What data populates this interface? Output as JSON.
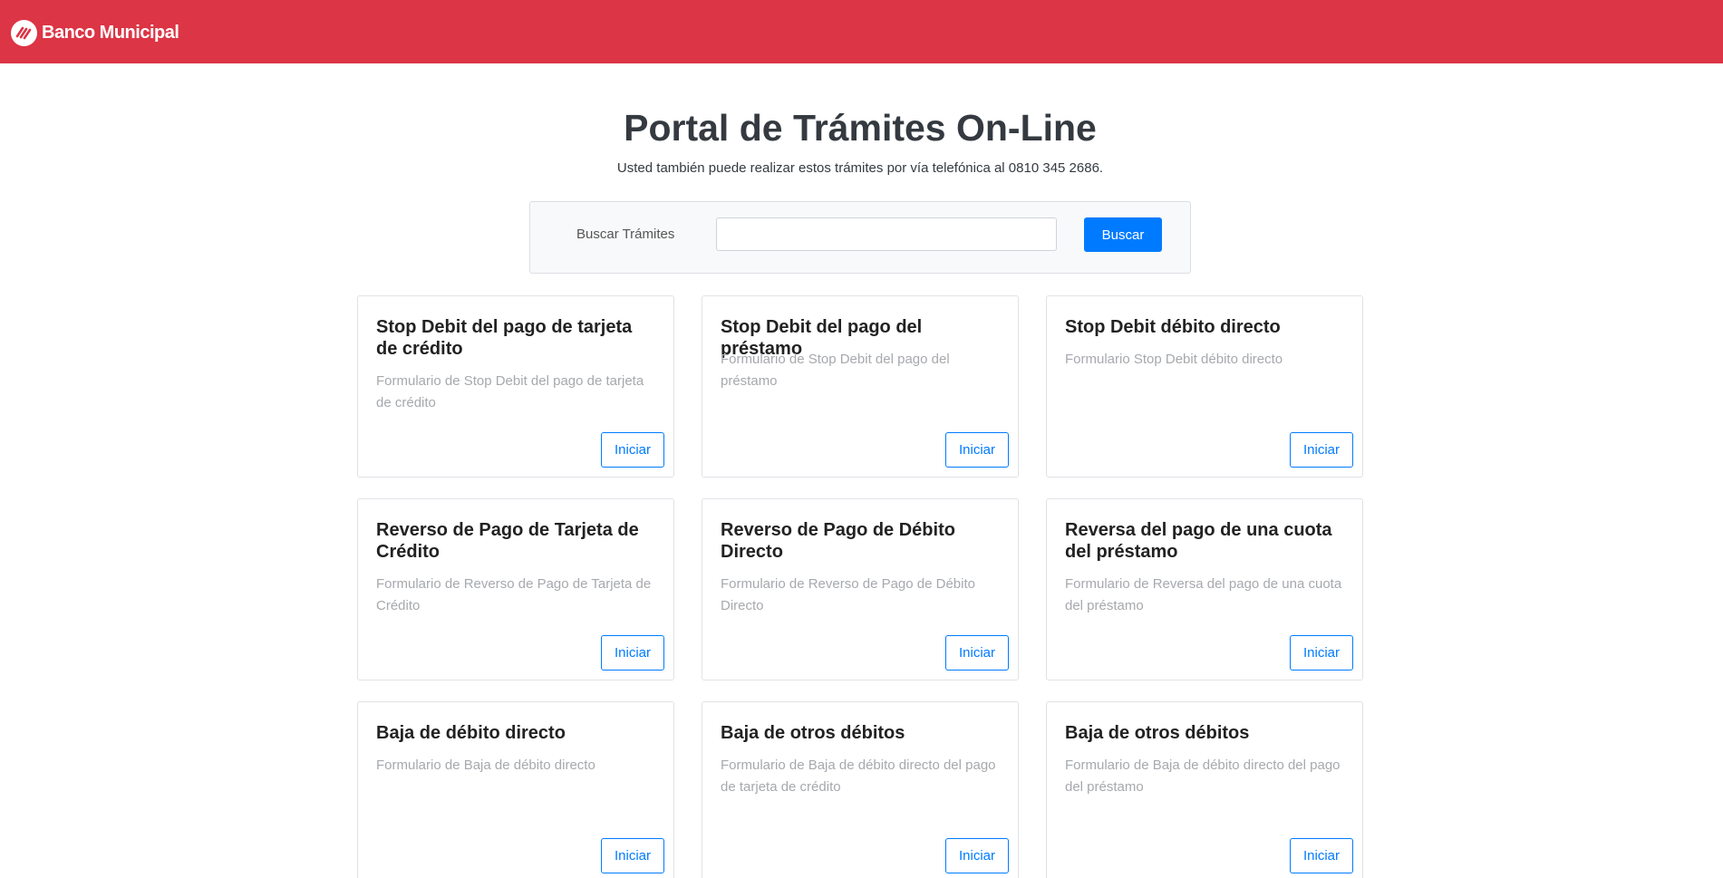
{
  "header": {
    "brand_name": "Banco Municipal",
    "logo_icon": "banco-municipal-logo-icon",
    "background_color": "#dc3545"
  },
  "main": {
    "title": "Portal de Trámites On-Line",
    "subtitle": "Usted también puede realizar estos trámites por vía telefónica al 0810 345 2686."
  },
  "search": {
    "label": "Buscar Trámites",
    "input_value": "",
    "placeholder": "",
    "button_label": "Buscar",
    "button_color": "#007bff"
  },
  "cards": [
    {
      "title": "Stop Debit del pago de tarjeta de crédito",
      "description": "Formulario de Stop Debit del pago de tarjeta de crédito",
      "button_label": "Iniciar"
    },
    {
      "title": "Stop Debit del pago del préstamo",
      "description": "Formulario de Stop Debit del pago del préstamo",
      "button_label": "Iniciar"
    },
    {
      "title": "Stop Debit débito directo",
      "description": "Formulario Stop Debit débito directo",
      "button_label": "Iniciar"
    },
    {
      "title": "Reverso de Pago de Tarjeta de Crédito",
      "description": "Formulario de Reverso de Pago de Tarjeta de Crédito",
      "button_label": "Iniciar"
    },
    {
      "title": "Reverso de Pago de Débito Directo",
      "description": "Formulario de Reverso de Pago de Débito Directo",
      "button_label": "Iniciar"
    },
    {
      "title": "Reversa del pago de una cuota del préstamo",
      "description": "Formulario de Reversa del pago de una cuota del préstamo",
      "button_label": "Iniciar"
    },
    {
      "title": "Baja de débito directo",
      "description": "Formulario de Baja de débito directo",
      "button_label": "Iniciar"
    },
    {
      "title": "Baja de otros débitos",
      "description": "Formulario de Baja de débito directo del pago de tarjeta de crédito",
      "button_label": "Iniciar"
    },
    {
      "title": "Baja de otros débitos",
      "description": "Formulario de Baja de débito directo del pago del préstamo",
      "button_label": "Iniciar"
    }
  ]
}
